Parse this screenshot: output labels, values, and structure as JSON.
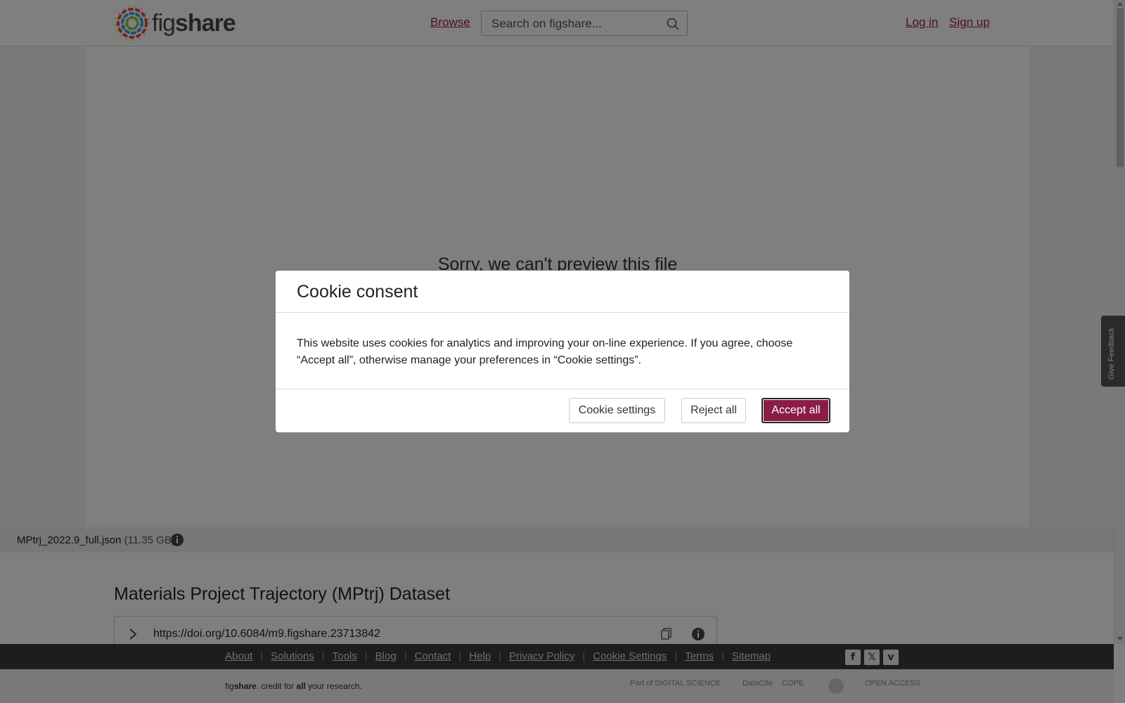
{
  "header": {
    "logo_fig": "fig",
    "logo_share": "share",
    "browse_label": "Browse",
    "search_placeholder": "Search on figshare...",
    "login_label": "Log in",
    "signup_label": "Sign up"
  },
  "preview": {
    "message": "Sorry, we can't preview this file"
  },
  "file": {
    "name": "MPtrj_2022.9_full.json",
    "size": "(11.35 GB)"
  },
  "dataset": {
    "title": "Materials Project Trajectory (MPtrj) Dataset",
    "doi": "https://doi.org/10.6084/m9.figshare.23713842"
  },
  "footer": {
    "links": [
      "About",
      "Solutions",
      "Tools",
      "Blog",
      "Contact",
      "Help",
      "Privacy Policy",
      "Cookie Settings",
      "Terms",
      "Sitemap"
    ],
    "tagline_fig": "fig",
    "tagline_share": "share",
    "tagline_mid": ". credit for ",
    "tagline_all": "all",
    "tagline_end": " your research.",
    "partner_digital": "Part of DIGITAL SCIENCE",
    "partner_datacite": "DataCite",
    "partner_cope": "COPE",
    "partner_oa": "OPEN ACCESS"
  },
  "feedback_label": "Give Feedback",
  "cookie_modal": {
    "title": "Cookie consent",
    "body": "This website uses cookies for analytics and improving your on-line experience. If you agree, choose “Accept all”, otherwise manage your preferences in “Cookie settings”.",
    "settings_label": "Cookie settings",
    "reject_label": "Reject all",
    "accept_label": "Accept all"
  },
  "colors": {
    "brand": "#a1164b",
    "accept_button": "#8a1c45"
  },
  "icons": [
    "search-icon",
    "info-icon",
    "chevron-right-icon",
    "copy-icon",
    "facebook-icon",
    "x-icon",
    "vimeo-icon"
  ]
}
